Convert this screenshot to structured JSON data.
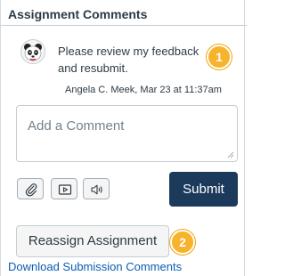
{
  "section": {
    "title": "Assignment Comments"
  },
  "comment": {
    "text": "Please review my feedback and resubmit.",
    "meta": "Angela C. Meek, Mar 23 at 11:37am",
    "avatar_icon": "panda-avatar-icon"
  },
  "callouts": {
    "one": "1",
    "two": "2"
  },
  "composer": {
    "placeholder": "Add a Comment",
    "value": ""
  },
  "media_buttons": [
    {
      "icon": "paperclip-icon"
    },
    {
      "icon": "media-play-icon"
    },
    {
      "icon": "audio-speaker-icon"
    }
  ],
  "actions": {
    "submit_label": "Submit",
    "reassign_label": "Reassign Assignment",
    "download_label": "Download Submission Comments"
  },
  "colors": {
    "submit_bg": "#1b3a5c",
    "badge": "#f7b32b",
    "link": "#0a5db0"
  }
}
